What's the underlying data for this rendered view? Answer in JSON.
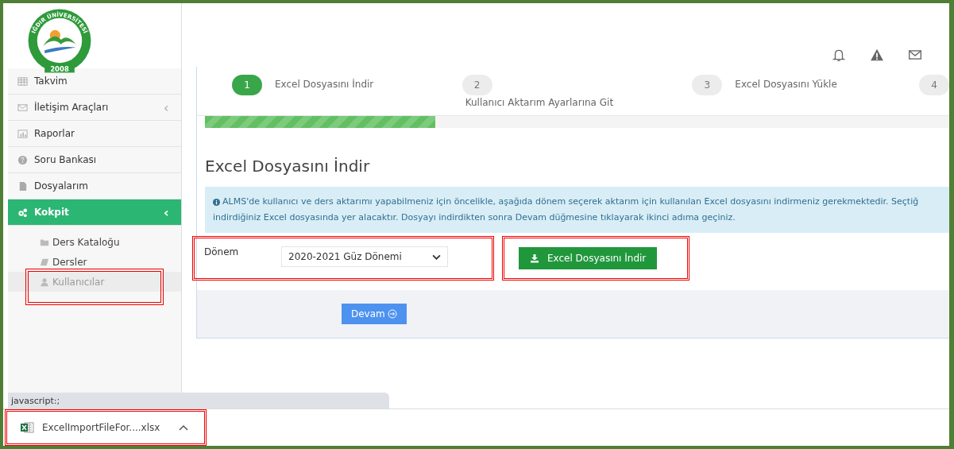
{
  "logo": {
    "arc_text": "IĞDIR ÜNİVERSİTESİ",
    "year": "2008"
  },
  "sidebar": {
    "items": [
      {
        "label": "Takvim",
        "kind": "calendar",
        "selected": false
      },
      {
        "label": "İletişim Araçları",
        "kind": "mail",
        "selected": false,
        "chevron": "‹"
      },
      {
        "label": "Raporlar",
        "kind": "chart",
        "selected": false
      },
      {
        "label": "Soru Bankası",
        "kind": "question",
        "selected": false
      },
      {
        "label": "Dosyalarım",
        "kind": "file",
        "selected": false
      },
      {
        "label": "Kokpit",
        "kind": "gears",
        "selected": true,
        "chevron": "‹",
        "children": [
          {
            "label": "Ders Kataloğu",
            "kind": "folder",
            "selected": false
          },
          {
            "label": "Dersler",
            "kind": "book",
            "selected": false
          },
          {
            "label": "Kullanıcılar",
            "kind": "user",
            "selected": true
          }
        ]
      }
    ]
  },
  "steps": [
    {
      "number": "1",
      "label": "Excel Dosyasını İndir",
      "selected": true
    },
    {
      "number": "2",
      "label": "Kullanıcı Aktarım Ayarlarına Git",
      "selected": false
    },
    {
      "number": "3",
      "label": "Excel Dosyasını Yükle",
      "selected": false
    },
    {
      "number": "4",
      "selected": false
    }
  ],
  "progress": {
    "level": 0.31
  },
  "section_title": "Excel Dosyasını İndir",
  "info": "ALMS'de kullanıcı ve ders aktarımı yapabilmeniz için öncelikle, aşağıda dönem seçerek aktarım için kullanılan Excel dosyasını indirmeniz gerekmektedir. Seçtiğ",
  "info_line2": "indirdiğiniz Excel dosyasında yer alacaktır. Dosyayı indirdikten sonra Devam düğmesine tıklayarak ikinci adıma geçiniz.",
  "form": {
    "label": "Dönem",
    "value": "2020-2021 Güz Dönemi",
    "button": "Excel Dosyasını İndir"
  },
  "continue_button": "Devam",
  "status_url": "javascript:;",
  "download": {
    "filename": "ExcelImportFileFor....xlsx"
  }
}
